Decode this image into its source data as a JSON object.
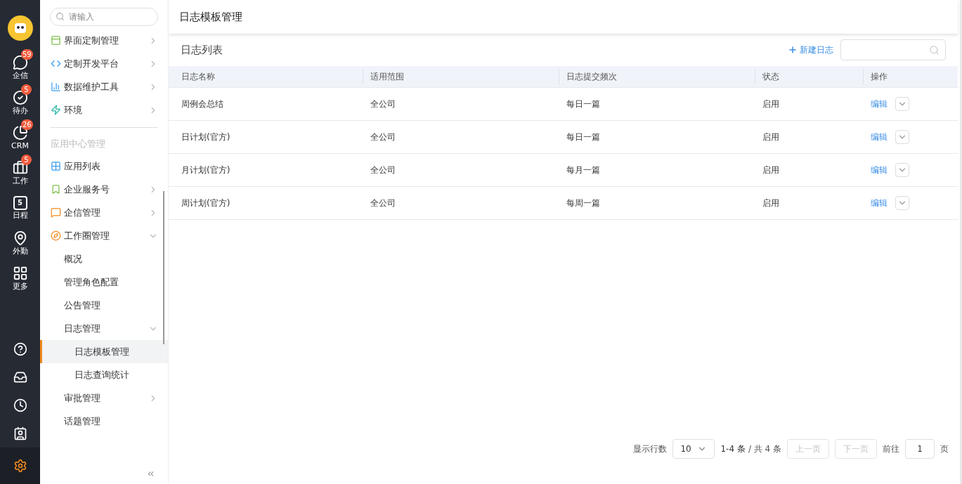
{
  "rail": {
    "badges_items": [
      {
        "label": "企信",
        "badge": "59"
      },
      {
        "label": "待办",
        "badge": "5"
      },
      {
        "label": "CRM",
        "badge": "26"
      },
      {
        "label": "工作",
        "badge": "5"
      },
      {
        "label": "日程",
        "day": "5"
      },
      {
        "label": "外勤"
      },
      {
        "label": "更多"
      }
    ],
    "bottom": [
      {
        "selected": false
      },
      {
        "selected": false
      },
      {
        "selected": false
      },
      {
        "selected": false
      },
      {
        "selected": true
      }
    ]
  },
  "sidebar": {
    "search": {
      "placeholder": "请输入"
    },
    "items": [
      {
        "label": "界面定制管理",
        "expanded": false
      },
      {
        "label": "定制开发平台",
        "expanded": false
      },
      {
        "label": "数据维护工具",
        "expanded": false
      },
      {
        "label": "环境",
        "expanded": false
      }
    ],
    "section": "应用中心管理",
    "app_items": [
      {
        "label": "应用列表"
      },
      {
        "label": "企业服务号",
        "expanded": false
      },
      {
        "label": "企信管理",
        "expanded": false
      },
      {
        "label": "工作圈管理",
        "expanded": true,
        "children": [
          {
            "label": "概况"
          },
          {
            "label": "管理角色配置"
          },
          {
            "label": "公告管理"
          },
          {
            "label": "日志管理",
            "expanded": true,
            "children": [
              {
                "label": "日志模板管理",
                "selected": true
              },
              {
                "label": "日志查询统计",
                "selected": false
              }
            ]
          },
          {
            "label": "审批管理",
            "expanded": false
          },
          {
            "label": "话题管理"
          }
        ]
      }
    ]
  },
  "header": {
    "title": "日志模板管理"
  },
  "list": {
    "title": "日志列表",
    "new_button": "新建日志"
  },
  "table": {
    "columns": [
      "日志名称",
      "适用范围",
      "日志提交频次",
      "状态",
      "操作"
    ],
    "rows": [
      {
        "name": "周例会总结",
        "scope": "全公司",
        "frequency": "每日一篇",
        "status": "启用",
        "action": "编辑"
      },
      {
        "name": "日计划(官方)",
        "scope": "全公司",
        "frequency": "每日一篇",
        "status": "启用",
        "action": "编辑"
      },
      {
        "name": "月计划(官方)",
        "scope": "全公司",
        "frequency": "每月一篇",
        "status": "启用",
        "action": "编辑"
      },
      {
        "name": "周计划(官方)",
        "scope": "全公司",
        "frequency": "每周一篇",
        "status": "启用",
        "action": "编辑"
      }
    ]
  },
  "pagination": {
    "rows_label": "显示行数",
    "rows_value": "10",
    "range": "1-4 条",
    "total": "/ 共 4 条",
    "prev": "上一页",
    "next": "下一页",
    "goto": "前往",
    "page": "1",
    "page_unit": "页"
  }
}
